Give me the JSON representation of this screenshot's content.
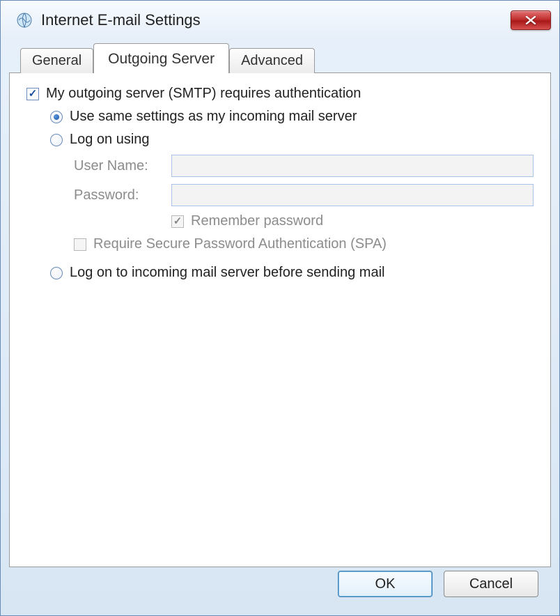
{
  "window": {
    "title": "Internet E-mail Settings"
  },
  "tabs": {
    "general": "General",
    "outgoing": "Outgoing Server",
    "advanced": "Advanced"
  },
  "form": {
    "smtp_auth_label": "My outgoing server (SMTP) requires authentication",
    "use_same_label": "Use same settings as my incoming mail server",
    "log_on_label": "Log on using",
    "username_label": "User Name:",
    "password_label": "Password:",
    "username_value": "",
    "password_value": "",
    "remember_label": "Remember password",
    "spa_label": "Require Secure Password Authentication (SPA)",
    "logon_incoming_label": "Log on to incoming mail server before sending mail"
  },
  "buttons": {
    "ok": "OK",
    "cancel": "Cancel"
  }
}
